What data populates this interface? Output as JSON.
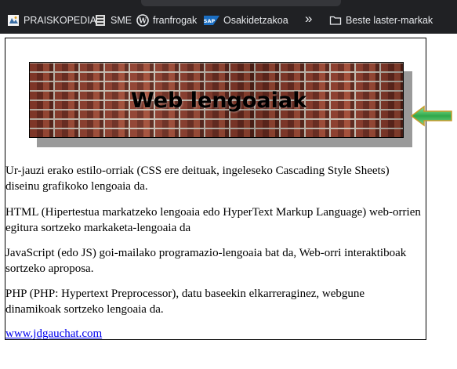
{
  "bookmarks": [
    {
      "label": "PRAISKOPEDIA",
      "icon": "praiskopedia-icon"
    },
    {
      "label": "SME",
      "icon": "sme-icon"
    },
    {
      "label": "franfrogak",
      "icon": "wordpress-icon"
    },
    {
      "label": "Osakidetzakoa",
      "icon": "sap-icon"
    },
    {
      "label": "Beste laster-markak",
      "icon": "folder-icon"
    }
  ],
  "overflow_label": "»",
  "banner": {
    "title": "Web lengoaiak",
    "logo_text_sap": "SAP"
  },
  "paragraphs": [
    "Ur-jauzi erako estilo-orriak (CSS ere deituak, ingeleseko Cascading Style Sheets) diseinu grafikoko lengoaia da.",
    "HTML (Hipertestua markatzeko lengoaia edo HyperText Markup Language) web-orrien egitura sortzeko markaketa-lengoaia da",
    "JavaScript (edo JS) goi-mailako programazio-lengoaia bat da, Web-orri interaktiboak sortzeko aproposa.",
    "PHP (PHP: Hypertext Preprocessor), datu baseekin elkarreraginez, webgune dinamikoak sortzeko lengoaia da."
  ],
  "link": "www.jdgauchat.com",
  "colors": {
    "link": "#0000ee",
    "bookmark_bar": "#202124",
    "arrow": "#3cb35a"
  }
}
